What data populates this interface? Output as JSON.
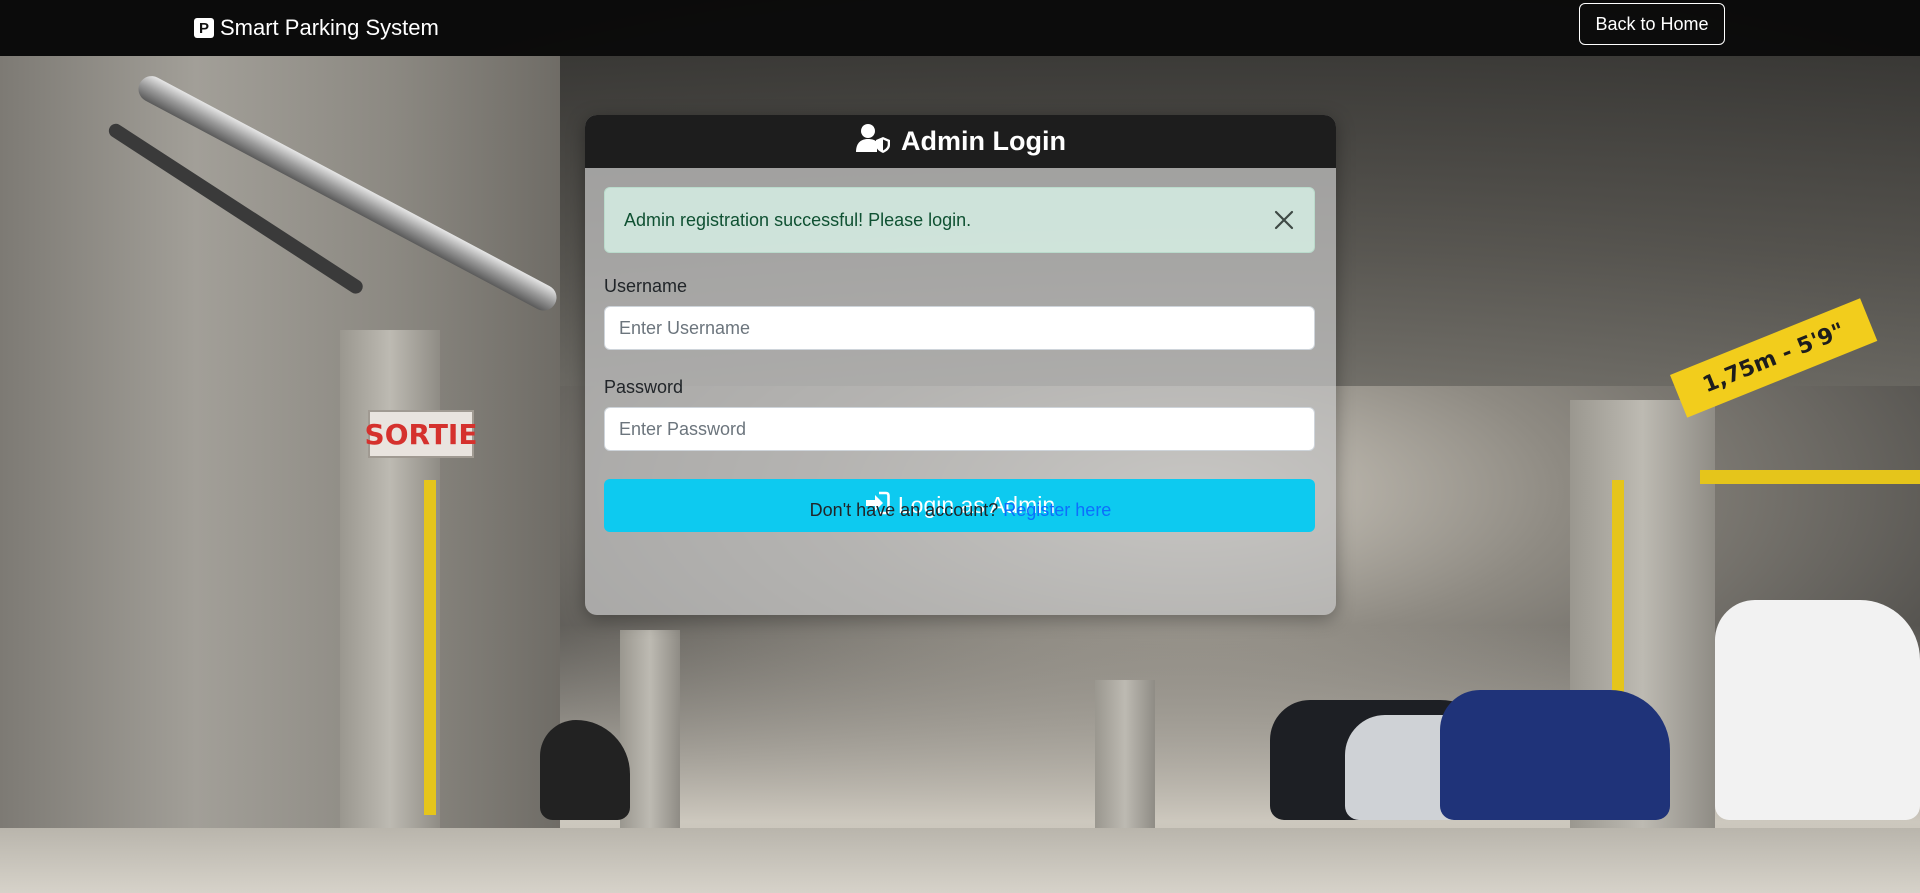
{
  "navbar": {
    "brand_icon": "P",
    "brand": "Smart Parking System",
    "back_button": "Back to Home"
  },
  "background": {
    "exit_sign": "SORTIE",
    "height_sign": "1,75m - 5'9\""
  },
  "login_card": {
    "title": "Admin Login",
    "title_icon": "user-shield-icon",
    "alert": {
      "message": "Admin registration successful! Please login.",
      "close_icon": "close-icon"
    },
    "username": {
      "label": "Username",
      "placeholder": "Enter Username",
      "value": ""
    },
    "password": {
      "label": "Password",
      "placeholder": "Enter Password",
      "value": ""
    },
    "submit": {
      "icon": "sign-in-icon",
      "label": "Login as Admin"
    },
    "register": {
      "prompt": "Don't have an account?",
      "link": "Register here"
    }
  },
  "colors": {
    "navbar_bg": "#0a0a0a",
    "card_header_bg": "#1d1d1d",
    "alert_bg": "#d1e7dd",
    "alert_text": "#0f5132",
    "button_info": "#0dcaf0",
    "link": "#0d6efd"
  }
}
